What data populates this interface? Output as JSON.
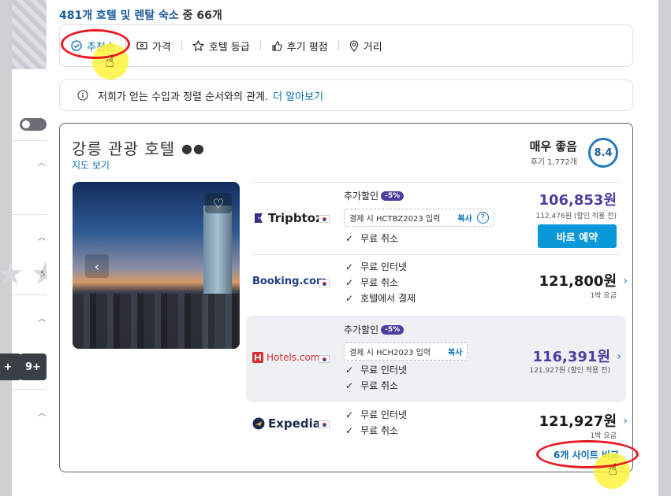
{
  "left": {
    "chip_plus": "+",
    "chip_nine": "9+",
    "star_number": "5"
  },
  "header": {
    "results_count": "481개 호텔 및 렌탈 숙소",
    "results_tail": " 중 66개"
  },
  "sort": {
    "items": [
      {
        "label": "추천순",
        "icon": "check-circle-icon",
        "active": true
      },
      {
        "label": "가격",
        "icon": "money-icon"
      },
      {
        "label": "호텔 등급",
        "icon": "star-outline-icon"
      },
      {
        "label": "후기 평점",
        "icon": "thumbs-up-icon"
      },
      {
        "label": "거리",
        "icon": "location-pin-icon"
      }
    ]
  },
  "info": {
    "text": "저희가 얻는 수입과 정렬 순서와의 관계.",
    "link": "더 알아보기"
  },
  "hotel": {
    "name": "강릉 관광 호텔",
    "dots": "●●",
    "map_link": "지도 보기",
    "rating_text": "매우 좋음",
    "review_count": "후기 1,772개",
    "score": "8.4"
  },
  "offers": [
    {
      "provider": "Tripbtoz",
      "extra_label": "추가할인",
      "extra_pct": "-5%",
      "coupon_text": "결제 시 HCTBZ2023 입력",
      "coupon_copy": "복사",
      "coupon_help": "?",
      "features": [
        "무료 취소"
      ],
      "price": "106,853원",
      "sub": "112,476원 (할인 적용 전)",
      "cta": "바로 예약"
    },
    {
      "provider": "Booking.com",
      "features": [
        "무료 인터넷",
        "무료 취소",
        "호텔에서 결제"
      ],
      "price": "121,800원",
      "sub": "1박 요금"
    },
    {
      "provider": "Hotels.com",
      "extra_label": "추가할인",
      "extra_pct": "-5%",
      "coupon_text": "결제 시 HCH2023 입력",
      "coupon_copy": "복사",
      "features": [
        "무료 인터넷",
        "무료 취소"
      ],
      "price": "116,391원",
      "sub": "121,927원 (할인 적용 전)"
    },
    {
      "provider": "Expedia",
      "features": [
        "무료 인터넷",
        "무료 취소"
      ],
      "price": "121,927원",
      "sub": "1박 요금"
    }
  ],
  "compare": "6개 사이트 비교",
  "colors": {
    "accent": "#0a6fb0",
    "purple_price": "#4b3fa0",
    "book_button": "#0a98d8",
    "annotation_red": "#e51c24",
    "highlight_yellow": "#fff33c"
  }
}
